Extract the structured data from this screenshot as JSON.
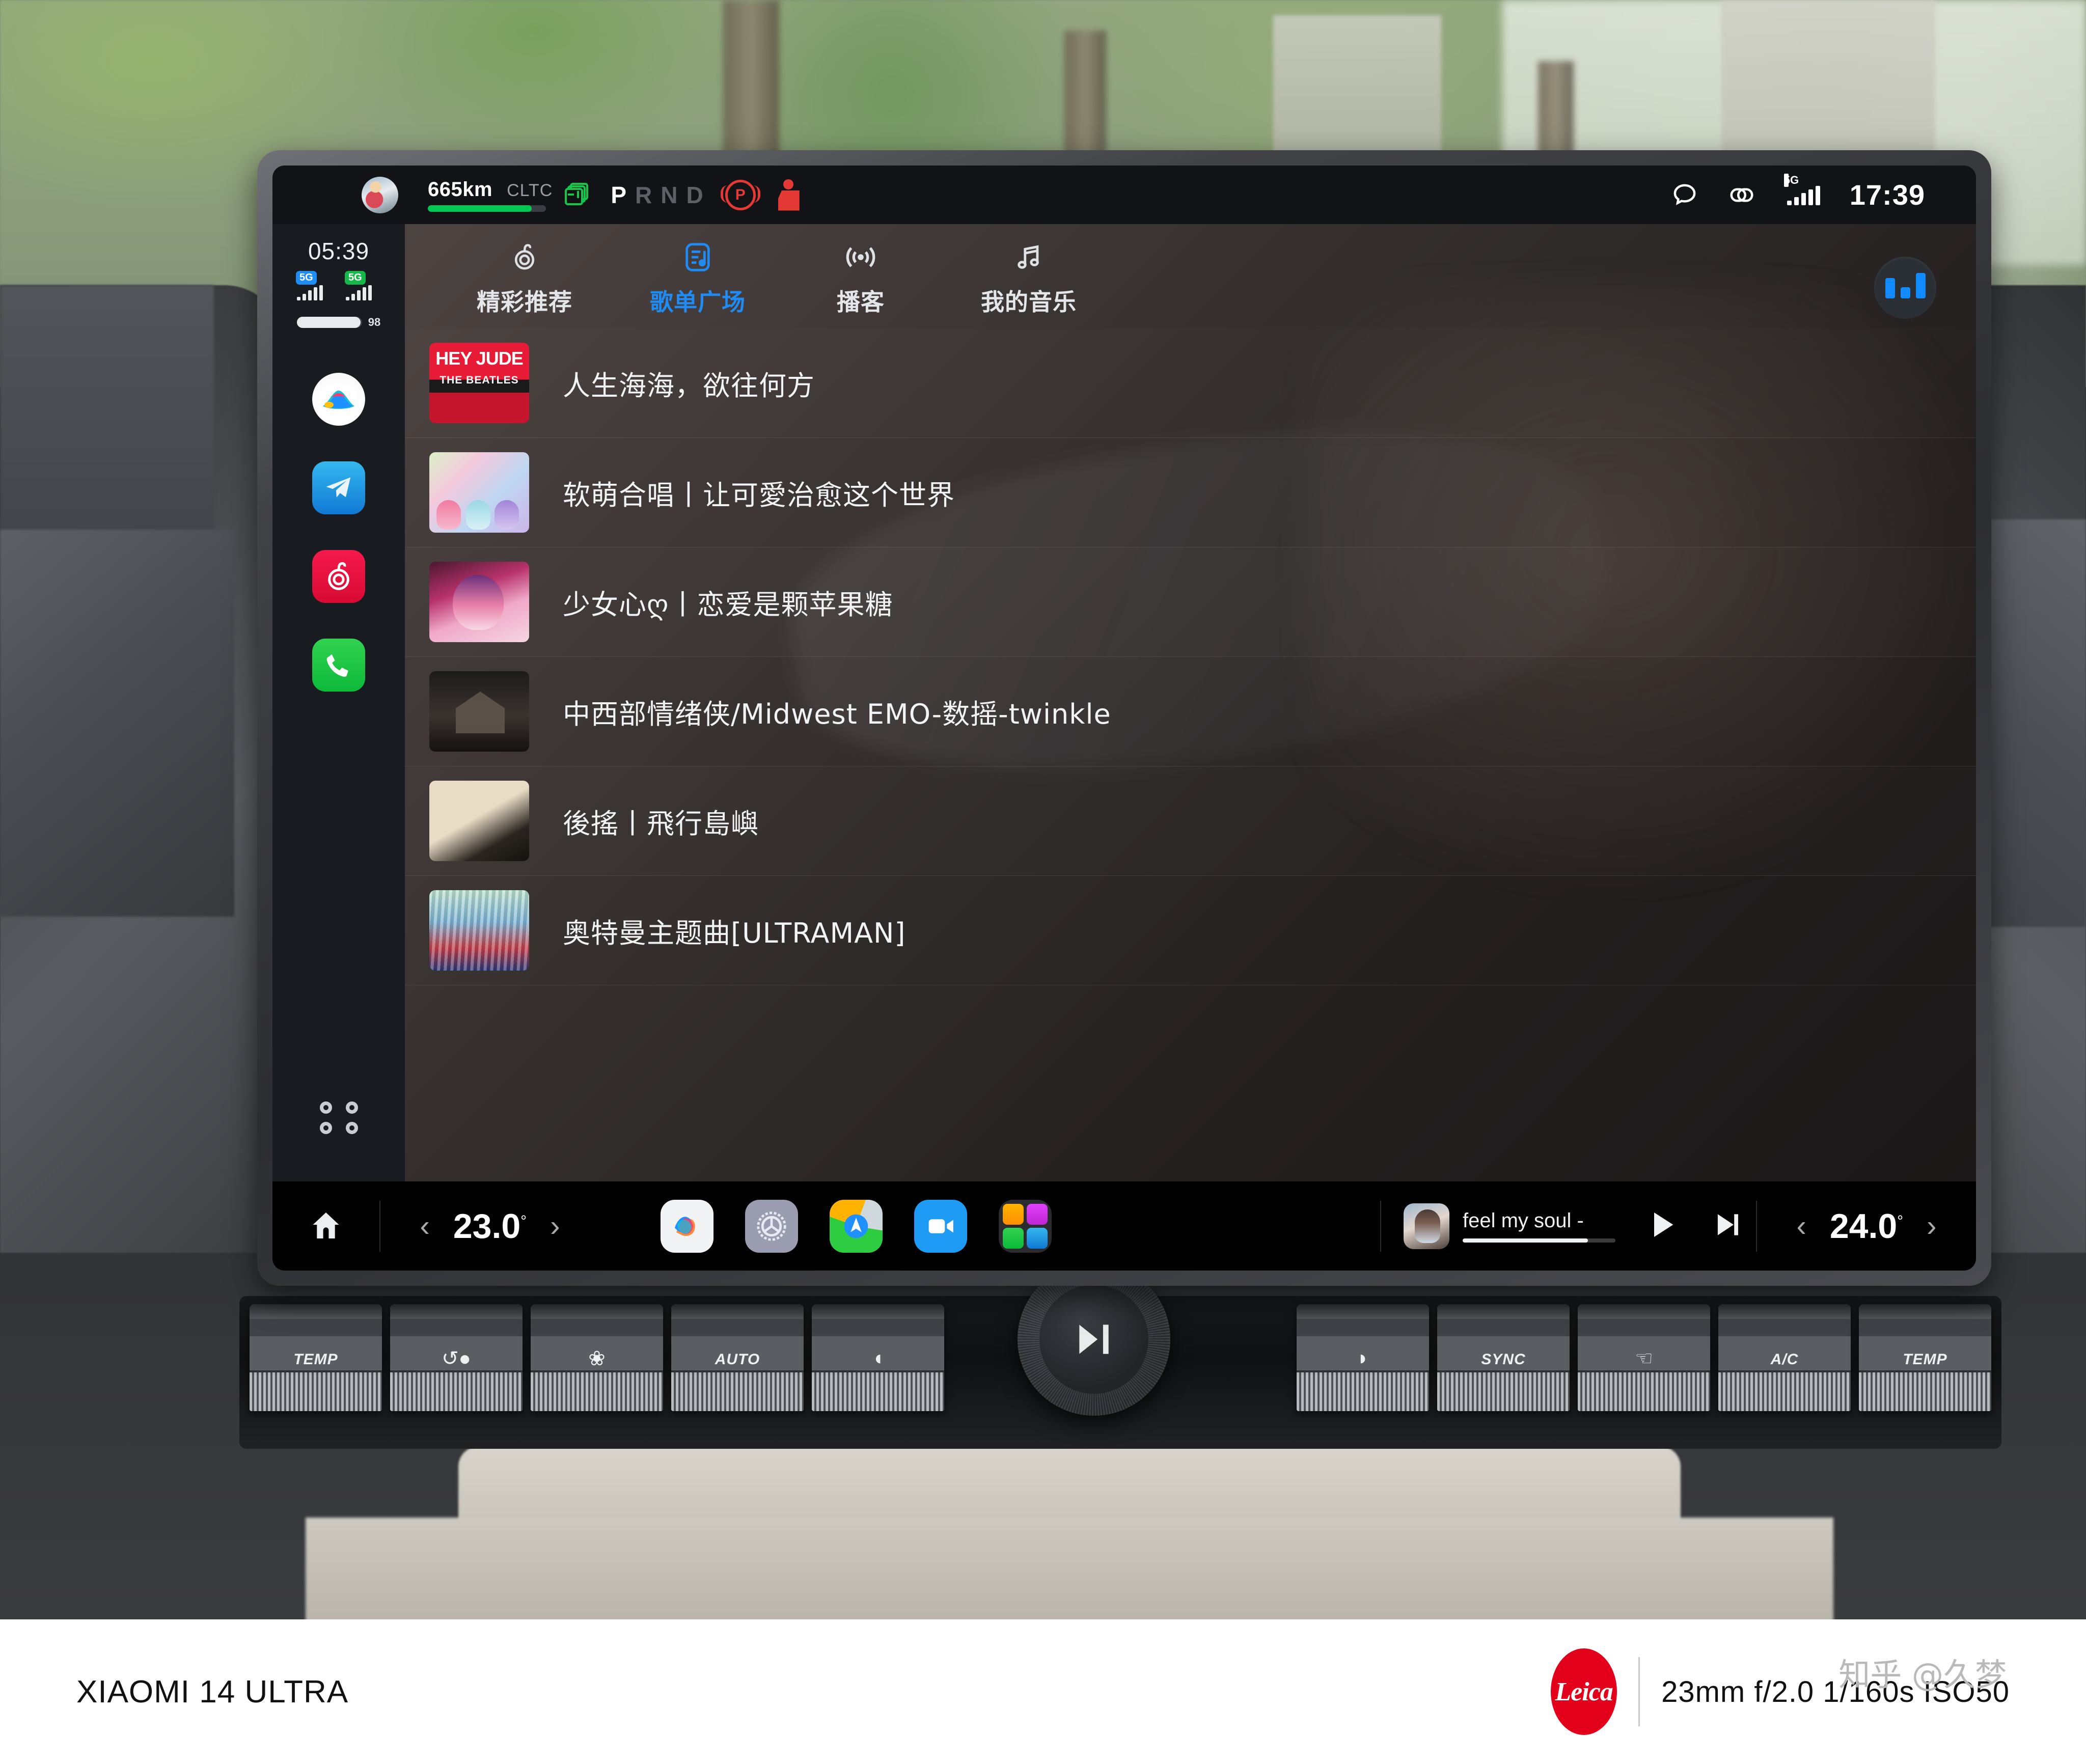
{
  "vehicle_status": {
    "range_value": "665km",
    "range_standard": "CLTC",
    "range_percent": 88,
    "gear_options": [
      "P",
      "R",
      "N",
      "D"
    ],
    "gear_active": "P",
    "icons": {
      "battery": "battery-icon",
      "parking_brake": "parking-brake-icon",
      "seatbelt": "seatbelt-warning-icon",
      "avatar": "driver-avatar"
    }
  },
  "statusbar_right": {
    "message_icon": "message-bubble-icon",
    "link_icon": "link-icon",
    "network_label": "5G",
    "time": "17:39"
  },
  "rail": {
    "time": "05:39",
    "sims": [
      {
        "label": "5G",
        "color": "#1e8df5",
        "bars": 4
      },
      {
        "label": "5G",
        "color": "#17b84a",
        "bars": 4
      }
    ],
    "volume_level": 98,
    "volume_label": "98",
    "apps": [
      {
        "name": "xiaomi-ai-icon",
        "label": "小爱同学"
      },
      {
        "name": "telegram-icon",
        "label": "Telegram"
      },
      {
        "name": "netease-music-icon",
        "label": "网易云音乐"
      },
      {
        "name": "phone-icon",
        "label": "电话"
      }
    ],
    "grid_icon": "app-grid-icon"
  },
  "app": {
    "tabs": [
      {
        "label": "精彩推荐",
        "icon": "netease-logo-icon",
        "active": false
      },
      {
        "label": "歌单广场",
        "icon": "playlist-icon",
        "active": true
      },
      {
        "label": "播客",
        "icon": "podcast-icon",
        "active": false
      },
      {
        "label": "我的音乐",
        "icon": "music-note-icon",
        "active": false
      }
    ],
    "equalizer_button": "equalizer-icon",
    "accent_color": "#1f8cf5",
    "playlists": [
      {
        "title": "人生海海，欲往何方",
        "cover": "cv-heyjude",
        "cover_text": [
          "HEY JUDE",
          "THE BEATLES"
        ]
      },
      {
        "title": "软萌合唱丨让可愛治愈这个世界",
        "cover": "cv-anime",
        "cover_text": []
      },
      {
        "title": "少女心ღ丨恋爱是颗苹果糖",
        "cover": "cv-girl",
        "cover_text": []
      },
      {
        "title": "中西部情绪侠/Midwest EMO-数摇-twinkle",
        "cover": "cv-house",
        "cover_text": []
      },
      {
        "title": "後搖丨飛行島嶼",
        "cover": "cv-beige",
        "cover_text": []
      },
      {
        "title": "奥特曼主题曲[ULTRAMAN]",
        "cover": "cv-ultra",
        "cover_text": []
      }
    ]
  },
  "taskbar": {
    "home_icon": "home-icon",
    "temp_left": {
      "value": "23.0",
      "unit": "°",
      "prev": "‹",
      "next": "›"
    },
    "temp_right": {
      "value": "24.0",
      "unit": "°",
      "prev": "‹",
      "next": "›"
    },
    "dock_apps": [
      {
        "name": "xiaomi-ai-dock-icon"
      },
      {
        "name": "settings-gear-icon"
      },
      {
        "name": "navigation-maps-icon"
      },
      {
        "name": "dashcam-icon"
      },
      {
        "name": "app-folder-icon"
      }
    ],
    "now_playing": {
      "title": "feel my soul - ",
      "progress": 82,
      "play_icon": "play-icon",
      "next_icon": "next-track-icon",
      "cover": "now-playing-cover"
    }
  },
  "hvac": {
    "left_keys": [
      {
        "label": "TEMP",
        "glyph": ""
      },
      {
        "label": "",
        "glyph": "air-recirculation-icon"
      },
      {
        "label": "",
        "glyph": "fan-icon"
      },
      {
        "label": "AUTO",
        "glyph": ""
      },
      {
        "label": "",
        "glyph": "rear-defrost-icon"
      }
    ],
    "right_keys": [
      {
        "label": "",
        "glyph": "front-defrost-icon"
      },
      {
        "label": "SYNC",
        "glyph": ""
      },
      {
        "label": "",
        "glyph": "air-mode-icon"
      },
      {
        "label": "A/C",
        "glyph": ""
      },
      {
        "label": "TEMP",
        "glyph": ""
      }
    ],
    "knob_icon": "play-pause-knob-icon"
  },
  "caption": {
    "device": "XIAOMI 14 ULTRA",
    "brand": "Leica",
    "exif": "23mm  f/2.0  1/160s  ISO50",
    "watermark": "知乎 @久梦"
  }
}
